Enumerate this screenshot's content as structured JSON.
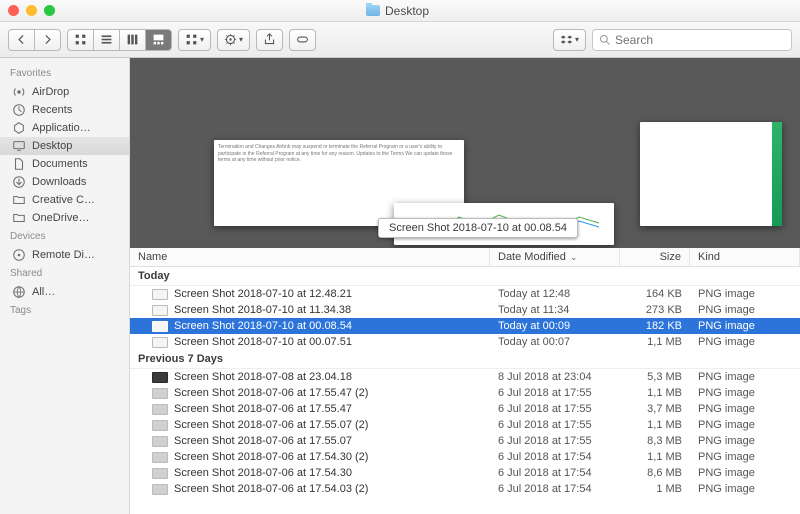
{
  "title": "Desktop",
  "search": {
    "placeholder": "Search"
  },
  "sidebar": {
    "sections": [
      {
        "header": "Favorites",
        "items": [
          {
            "label": "AirDrop",
            "icon": "airdrop",
            "selected": false
          },
          {
            "label": "Recents",
            "icon": "recents",
            "selected": false
          },
          {
            "label": "Applicatio…",
            "icon": "apps",
            "selected": false
          },
          {
            "label": "Desktop",
            "icon": "desktop",
            "selected": true
          },
          {
            "label": "Documents",
            "icon": "documents",
            "selected": false
          },
          {
            "label": "Downloads",
            "icon": "downloads",
            "selected": false
          },
          {
            "label": "Creative C…",
            "icon": "folder",
            "selected": false
          },
          {
            "label": "OneDrive…",
            "icon": "folder",
            "selected": false
          }
        ]
      },
      {
        "header": "Devices",
        "items": [
          {
            "label": "Remote Di…",
            "icon": "disk",
            "selected": false
          }
        ]
      },
      {
        "header": "Shared",
        "items": [
          {
            "label": "All…",
            "icon": "network",
            "selected": false
          }
        ]
      },
      {
        "header": "Tags",
        "items": []
      }
    ]
  },
  "preview_label": "Screen Shot 2018-07-10 at 00.08.54",
  "preview_text_a": "Termination and Changes\nAirbnb may suspend or terminate the Referral Program or a user's ability to participate in the Referral Program at any time for any reason.\nUpdates to the Terms\nWe can update these terms at any time without prior notice.",
  "columns": {
    "name": "Name",
    "date": "Date Modified",
    "size": "Size",
    "kind": "Kind"
  },
  "groups": [
    {
      "title": "Today",
      "rows": [
        {
          "name": "Screen Shot 2018-07-10 at 12.48.21",
          "date": "Today at 12:48",
          "size": "164 KB",
          "kind": "PNG image",
          "ico": "light",
          "selected": false
        },
        {
          "name": "Screen Shot 2018-07-10 at 11.34.38",
          "date": "Today at 11:34",
          "size": "273 KB",
          "kind": "PNG image",
          "ico": "light",
          "selected": false
        },
        {
          "name": "Screen Shot 2018-07-10 at 00.08.54",
          "date": "Today at 00:09",
          "size": "182 KB",
          "kind": "PNG image",
          "ico": "light",
          "selected": true
        },
        {
          "name": "Screen Shot 2018-07-10 at 00.07.51",
          "date": "Today at 00:07",
          "size": "1,1 MB",
          "kind": "PNG image",
          "ico": "light",
          "selected": false
        }
      ]
    },
    {
      "title": "Previous 7 Days",
      "rows": [
        {
          "name": "Screen Shot 2018-07-08 at 23.04.18",
          "date": "8 Jul 2018 at 23:04",
          "size": "5,3 MB",
          "kind": "PNG image",
          "ico": "dark",
          "selected": false
        },
        {
          "name": "Screen Shot 2018-07-06 at 17.55.47 (2)",
          "date": "6 Jul 2018 at 17:55",
          "size": "1,1 MB",
          "kind": "PNG image",
          "ico": "gray",
          "selected": false
        },
        {
          "name": "Screen Shot 2018-07-06 at 17.55.47",
          "date": "6 Jul 2018 at 17:55",
          "size": "3,7 MB",
          "kind": "PNG image",
          "ico": "gray",
          "selected": false
        },
        {
          "name": "Screen Shot 2018-07-06 at 17.55.07 (2)",
          "date": "6 Jul 2018 at 17:55",
          "size": "1,1 MB",
          "kind": "PNG image",
          "ico": "gray",
          "selected": false
        },
        {
          "name": "Screen Shot 2018-07-06 at 17.55.07",
          "date": "6 Jul 2018 at 17:55",
          "size": "8,3 MB",
          "kind": "PNG image",
          "ico": "gray",
          "selected": false
        },
        {
          "name": "Screen Shot 2018-07-06 at 17.54.30 (2)",
          "date": "6 Jul 2018 at 17:54",
          "size": "1,1 MB",
          "kind": "PNG image",
          "ico": "gray",
          "selected": false
        },
        {
          "name": "Screen Shot 2018-07-06 at 17.54.30",
          "date": "6 Jul 2018 at 17:54",
          "size": "8,6 MB",
          "kind": "PNG image",
          "ico": "gray",
          "selected": false
        },
        {
          "name": "Screen Shot 2018-07-06 at 17.54.03 (2)",
          "date": "6 Jul 2018 at 17:54",
          "size": "1 MB",
          "kind": "PNG image",
          "ico": "gray",
          "selected": false
        }
      ]
    }
  ]
}
